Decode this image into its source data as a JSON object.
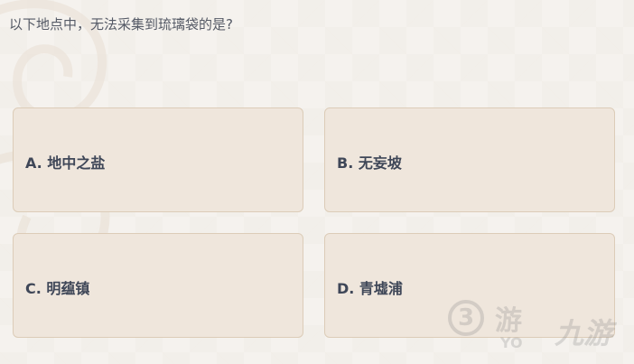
{
  "question": "以下地点中，无法采集到琉璃袋的是?",
  "options": [
    {
      "label": "A. 地中之盐"
    },
    {
      "label": "B. 无妄坡"
    },
    {
      "label": "C. 明蕴镇"
    },
    {
      "label": "D. 青墟浦"
    }
  ],
  "watermark": {
    "circle_text": "3",
    "glyph": "游",
    "sub": "YO",
    "logo": "九游"
  }
}
